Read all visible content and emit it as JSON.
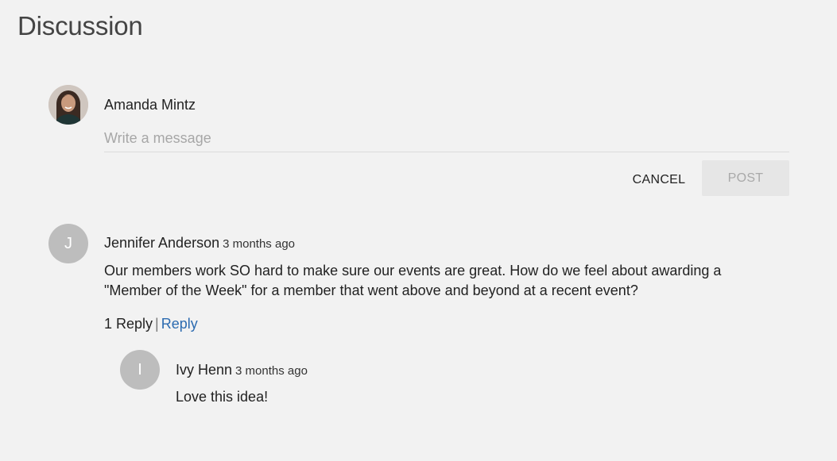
{
  "page": {
    "title": "Discussion"
  },
  "composer": {
    "author_name": "Amanda Mintz",
    "placeholder": "Write a message",
    "value": "",
    "cancel_label": "CANCEL",
    "post_label": "POST"
  },
  "comments": [
    {
      "author": "Jennifer Anderson",
      "initial": "J",
      "time": "3 months ago",
      "body_line1": "Our members work SO hard to make sure our events are great. How do we feel about awarding a",
      "body_line2": "\"Member of the Week\" for a member that went above and beyond at a recent event?",
      "reply_count": "1 Reply",
      "separator": "|",
      "reply_label": "Reply",
      "replies": [
        {
          "author": "Ivy Henn",
          "initial": "I",
          "time": "3 months ago",
          "body": "Love this idea!"
        }
      ]
    }
  ],
  "colors": {
    "background": "#f2f2f2",
    "link": "#2c6bb0",
    "avatar_placeholder": "#bdbdbd",
    "post_button_disabled": "#e6e6e6"
  }
}
